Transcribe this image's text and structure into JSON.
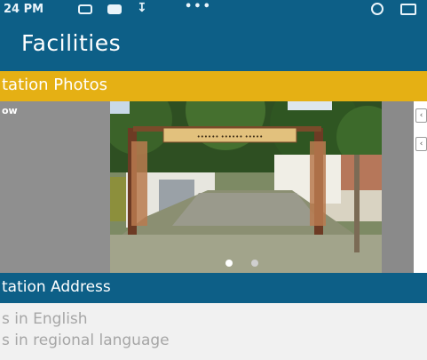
{
  "statusbar": {
    "time": "24 PM",
    "more": "•••"
  },
  "header": {
    "title": "Facilities"
  },
  "photos_section": {
    "label": "tation Photos"
  },
  "carousel": {
    "prev_caption": "ow",
    "photo_sign": "•••••• •••••• •••••",
    "side_top": "‹",
    "side_bottom": "‹",
    "active_slide": 1,
    "slide_count": 2
  },
  "address_section": {
    "label": "tation Address",
    "english": "s in English",
    "regional": "s in regional language"
  },
  "colors": {
    "primary": "#0d5f87",
    "accent": "#e5b014"
  },
  "icons": [
    "message-icon",
    "youtube-icon",
    "download-icon",
    "alarm-icon",
    "battery-icon"
  ]
}
